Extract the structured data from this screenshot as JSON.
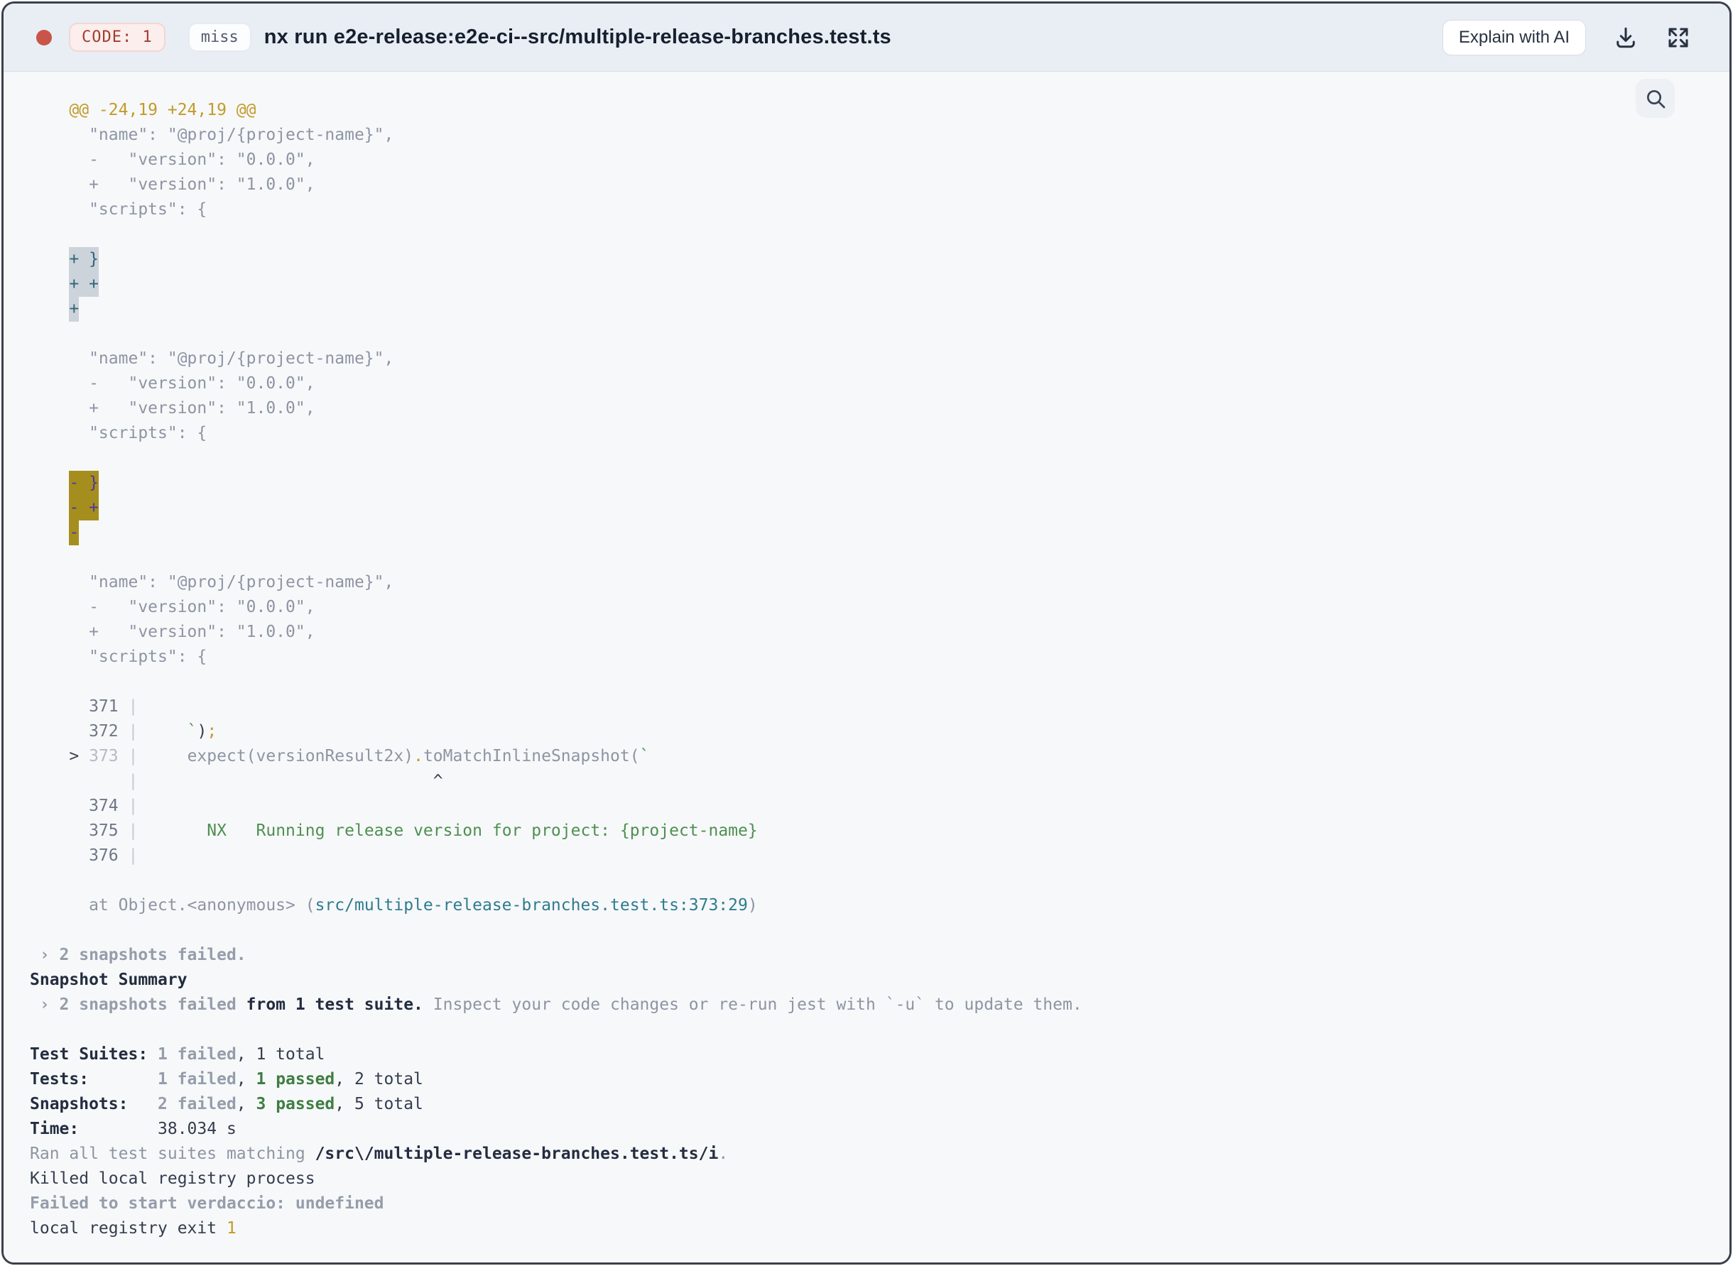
{
  "header": {
    "status_dot_color": "#c8544a",
    "code_badge": "CODE: 1",
    "miss_badge": "miss",
    "title": "nx run e2e-release:e2e-ci--src/multiple-release-branches.test.ts",
    "explain_button": "Explain with AI",
    "icons": [
      "download-icon",
      "expand-icon"
    ]
  },
  "terminal": {
    "search_icon": "magnifier",
    "colors": {
      "background": "#f7f8fa",
      "diff_hunk_gold": "#c29b28",
      "selection_gray_bg": "#cdd3da",
      "selection_gray_text": "#2f6479",
      "selection_olive_bg": "#a68e1e",
      "selection_olive_text": "#4c3b9a",
      "pass_green": "#3e7e42",
      "file_link_teal": "#2e7c8e"
    },
    "lines": [
      [
        [
          "gold",
          "    @@ -24,19 +24,19 @@"
        ]
      ],
      [
        [
          "dim",
          "      \"name\": \"@proj/{project-name}\","
        ]
      ],
      [
        [
          "dim",
          "      -   \"version\": \"0.0.0\","
        ]
      ],
      [
        [
          "dim",
          "      +   \"version\": \"1.0.0\","
        ]
      ],
      [
        [
          "dim",
          "      \"scripts\": {"
        ]
      ],
      [],
      [
        [
          "dim",
          "    "
        ],
        [
          "sel-gray",
          "+ }"
        ]
      ],
      [
        [
          "dim",
          "    "
        ],
        [
          "sel-gray",
          "+ +"
        ]
      ],
      [
        [
          "dim",
          "    "
        ],
        [
          "sel-gray",
          "+"
        ]
      ],
      [],
      [
        [
          "dim",
          "      \"name\": \"@proj/{project-name}\","
        ]
      ],
      [
        [
          "dim",
          "      -   \"version\": \"0.0.0\","
        ]
      ],
      [
        [
          "dim",
          "      +   \"version\": \"1.0.0\","
        ]
      ],
      [
        [
          "dim",
          "      \"scripts\": {"
        ]
      ],
      [],
      [
        [
          "dim",
          "    "
        ],
        [
          "sel-olive",
          "- }"
        ]
      ],
      [
        [
          "dim",
          "    "
        ],
        [
          "sel-olive",
          "- +"
        ]
      ],
      [
        [
          "dim",
          "    "
        ],
        [
          "sel-olive",
          "-"
        ]
      ],
      [],
      [
        [
          "dim",
          "      \"name\": \"@proj/{project-name}\","
        ]
      ],
      [
        [
          "dim",
          "      -   \"version\": \"0.0.0\","
        ]
      ],
      [
        [
          "dim",
          "      +   \"version\": \"1.0.0\","
        ]
      ],
      [
        [
          "dim",
          "      \"scripts\": {"
        ]
      ],
      [],
      [
        [
          "lineno",
          "      371 "
        ],
        [
          "pipe",
          "|"
        ]
      ],
      [
        [
          "lineno",
          "      372 "
        ],
        [
          "pipe",
          "|"
        ],
        [
          "dim",
          "     "
        ],
        [
          "green",
          "`"
        ],
        [
          "dark",
          ")"
        ],
        [
          "gold",
          ";"
        ]
      ],
      [
        [
          "marker",
          "    > "
        ],
        [
          "lineno-dim",
          "373 "
        ],
        [
          "pipe",
          "|"
        ],
        [
          "dim",
          "     expect(versionResult2x)"
        ],
        [
          "gold",
          "."
        ],
        [
          "dim",
          "toMatchInlineSnapshot("
        ],
        [
          "green",
          "`"
        ]
      ],
      [
        [
          "dim",
          "          "
        ],
        [
          "pipe",
          "|"
        ],
        [
          "marker",
          "                              ^"
        ]
      ],
      [
        [
          "lineno",
          "      374 "
        ],
        [
          "pipe",
          "|"
        ]
      ],
      [
        [
          "lineno",
          "      375 "
        ],
        [
          "pipe",
          "|"
        ],
        [
          "green",
          "       NX   Running release version for project: {project-name}"
        ]
      ],
      [
        [
          "lineno",
          "      376 "
        ],
        [
          "pipe",
          "|"
        ]
      ],
      [],
      [
        [
          "dim",
          "      at Object.<anonymous> ("
        ],
        [
          "teal",
          "src/multiple-release-branches.test.ts:373:29"
        ],
        [
          "dim",
          ")"
        ]
      ],
      [],
      [
        [
          "bold-dim",
          " › 2 snapshots failed."
        ]
      ],
      [
        [
          "bold-dark",
          "Snapshot Summary"
        ]
      ],
      [
        [
          "bold-dim",
          " › 2 snapshots failed"
        ],
        [
          "bold-dark",
          " from 1 test suite."
        ],
        [
          "dim",
          " Inspect your code changes or re-run jest with `-u` to update them."
        ]
      ],
      [],
      [
        [
          "bold-dark",
          "Test Suites: "
        ],
        [
          "bold-dim",
          "1 failed"
        ],
        [
          "dark",
          ", 1 total"
        ]
      ],
      [
        [
          "bold-dark",
          "Tests:       "
        ],
        [
          "bold-dim",
          "1 failed"
        ],
        [
          "dark",
          ", "
        ],
        [
          "bold-green",
          "1 passed"
        ],
        [
          "dark",
          ", 2 total"
        ]
      ],
      [
        [
          "bold-dark",
          "Snapshots:   "
        ],
        [
          "bold-dim",
          "2 failed"
        ],
        [
          "dark",
          ", "
        ],
        [
          "bold-green",
          "3 passed"
        ],
        [
          "dark",
          ", 5 total"
        ]
      ],
      [
        [
          "bold-dark",
          "Time:        "
        ],
        [
          "dark",
          "38.034 s"
        ]
      ],
      [
        [
          "dim",
          "Ran all test suites matching "
        ],
        [
          "bold-dark",
          "/src\\/multiple-release-branches.test.ts/i"
        ],
        [
          "dim",
          "."
        ]
      ],
      [
        [
          "dark",
          "Killed local registry process"
        ]
      ],
      [
        [
          "bold-dim",
          "Failed to start verdaccio: undefined"
        ]
      ],
      [
        [
          "dark",
          "local registry exit "
        ],
        [
          "gold",
          "1"
        ]
      ]
    ]
  }
}
